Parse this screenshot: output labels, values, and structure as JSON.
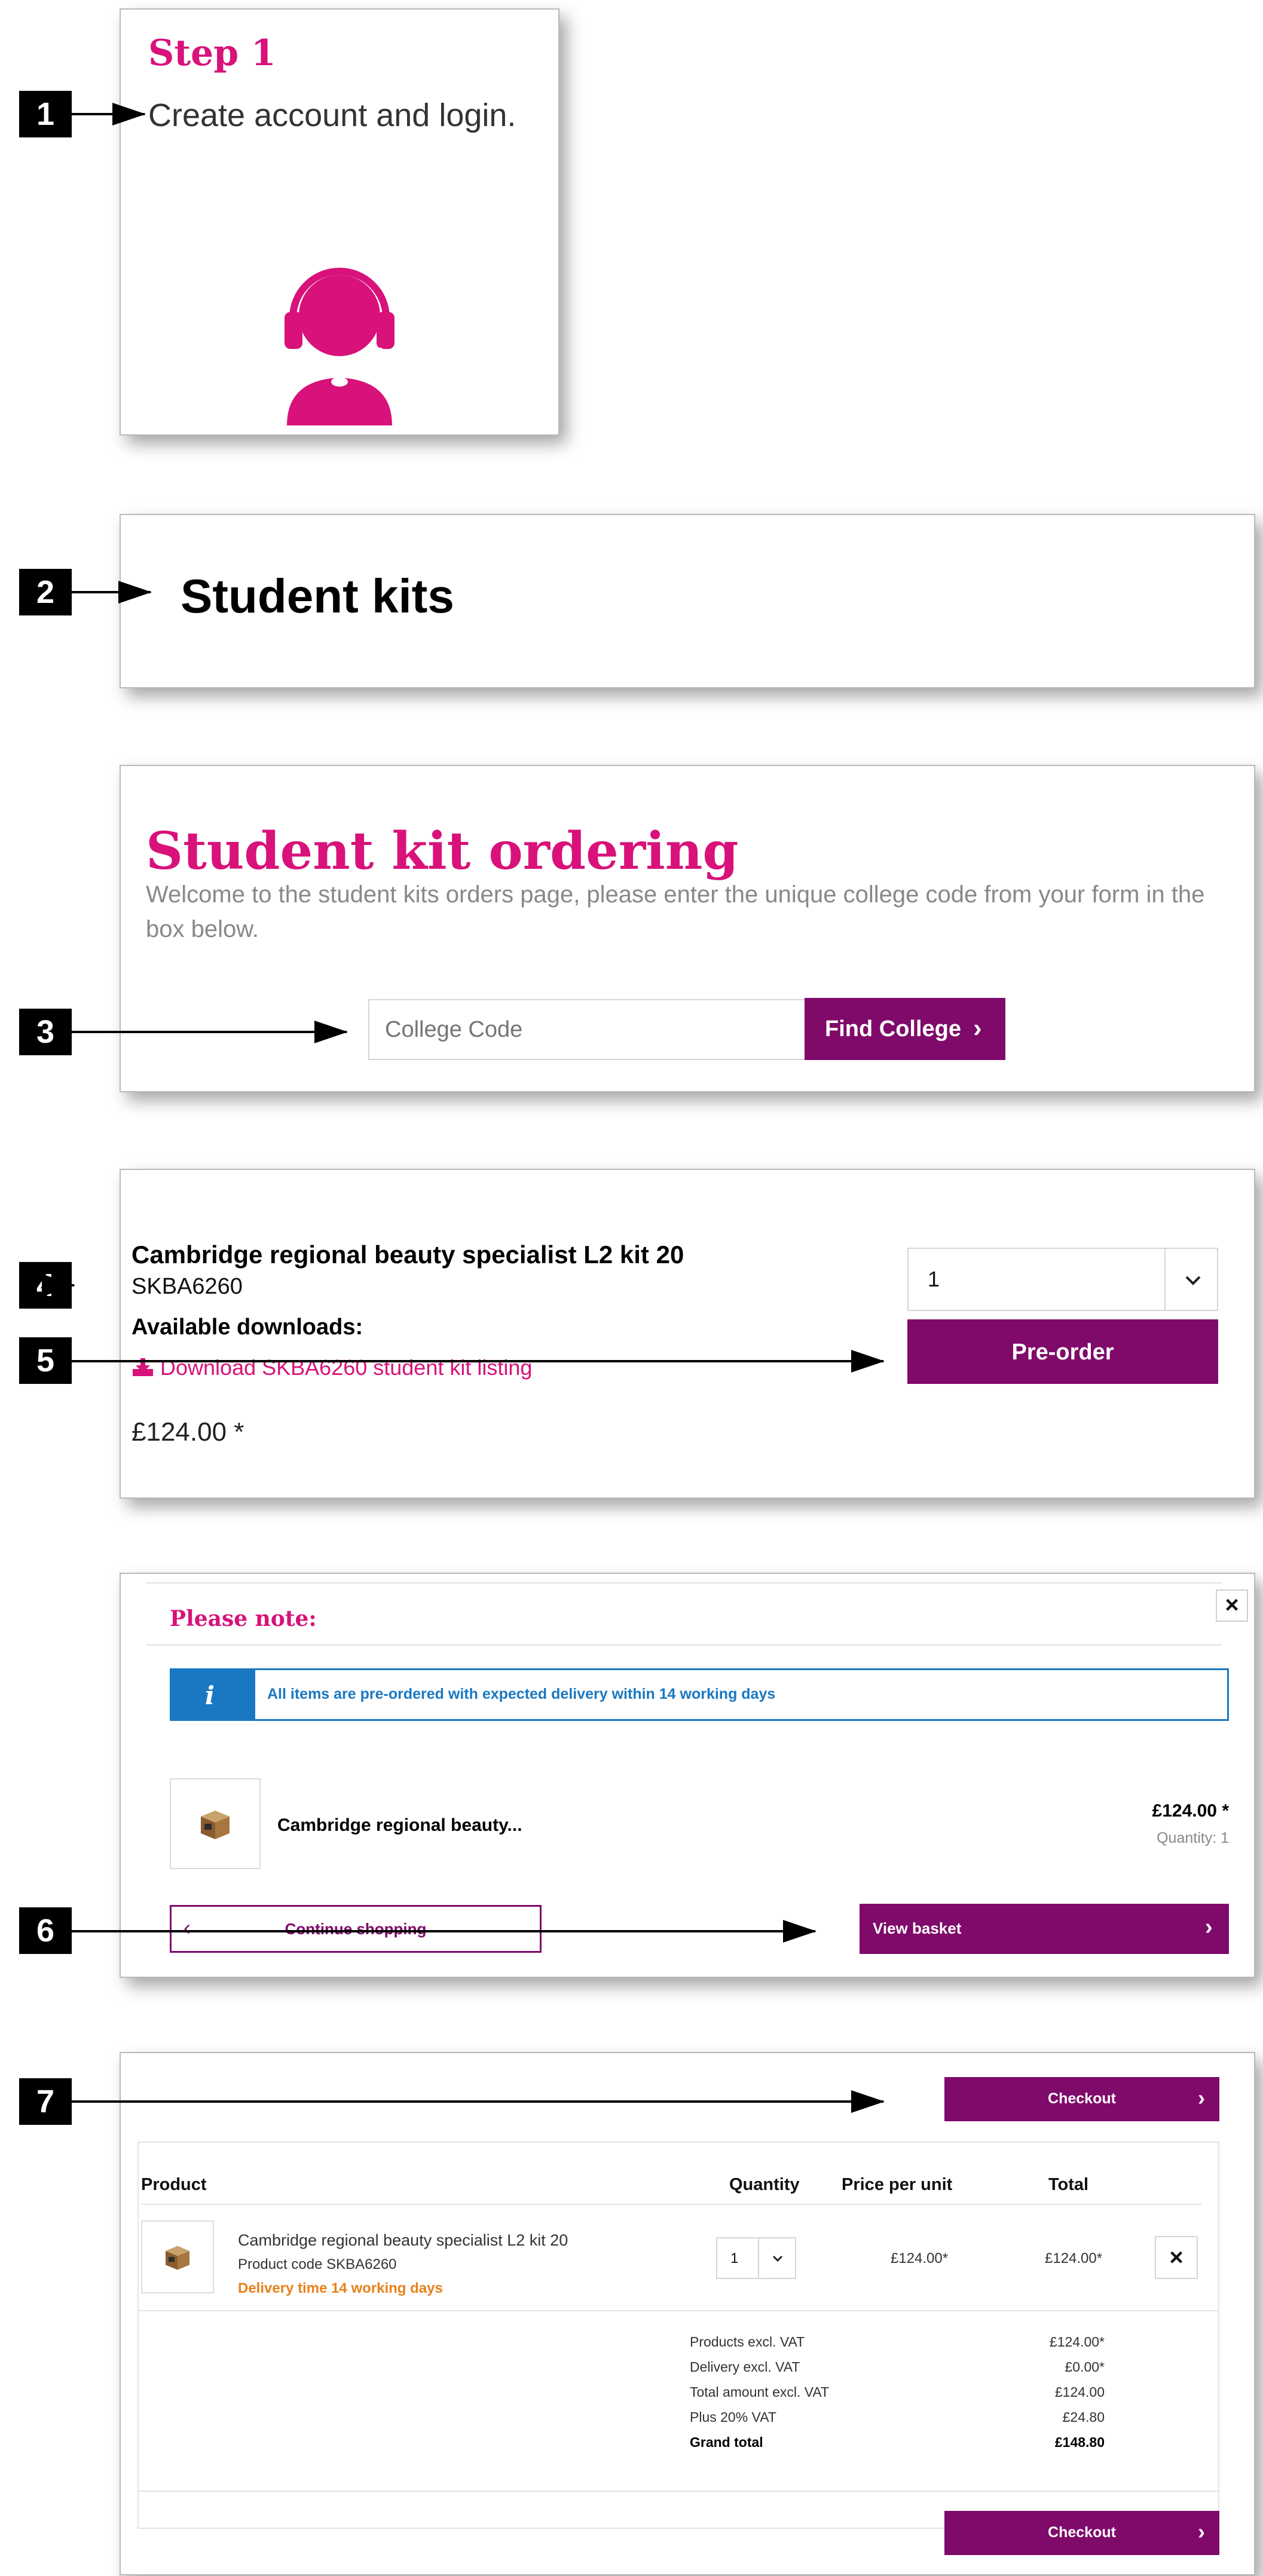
{
  "colors": {
    "brand_pink": "#d8127a",
    "brand_purple": "#7f0a6a",
    "info_blue": "#1a78c2",
    "delivery_orange": "#e8811a"
  },
  "badges": [
    "1",
    "2",
    "3",
    "4",
    "5",
    "6",
    "7"
  ],
  "step1": {
    "title": "Step 1",
    "text": "Create account and login.",
    "icon": "support-agent-icon"
  },
  "step2": {
    "title": "Student kits"
  },
  "step3": {
    "title": "Student kit ordering",
    "description": "Welcome to the student kits orders page, please enter the unique college code from your form in the box below.",
    "input_placeholder": "College Code",
    "button_label": "Find College",
    "button_icon": "chevron-right-icon"
  },
  "step4": {
    "product_name": "Cambridge regional beauty specialist L2 kit 20",
    "product_code": "SKBA6260",
    "downloads_heading": "Available downloads:",
    "download_link": "Download SKBA6260 student kit listing",
    "download_icon": "download-icon",
    "price": "£124.00 *",
    "quantity_value": "1",
    "select_icon": "chevron-down-icon",
    "preorder_label": "Pre-order"
  },
  "step6": {
    "title": "Please note:",
    "close_label": "×",
    "info_icon": "info-icon",
    "info_text": "All items are pre-ordered with expected delivery within 14 working days",
    "item_name": "Cambridge regional beauty...",
    "item_price": "£124.00 *",
    "item_quantity": "Quantity: 1",
    "continue_label": "Continue shopping",
    "view_basket_label": "View basket"
  },
  "step7": {
    "checkout_label": "Checkout",
    "table_headers": {
      "product": "Product",
      "quantity": "Quantity",
      "price_per_unit": "Price per unit",
      "total": "Total"
    },
    "item": {
      "name": "Cambridge regional beauty specialist L2 kit 20",
      "code": "Product code SKBA6260",
      "delivery": "Delivery time 14 working days",
      "quantity": "1",
      "unit_price": "£124.00*",
      "total": "£124.00*",
      "remove_label": "×"
    },
    "summary": [
      {
        "label": "Products excl. VAT",
        "value": "£124.00*"
      },
      {
        "label": "Delivery excl. VAT",
        "value": "£0.00*"
      },
      {
        "label": "Total amount excl. VAT",
        "value": "£124.00"
      },
      {
        "label": "Plus 20% VAT",
        "value": "£24.80"
      },
      {
        "label": "Grand total",
        "value": "£148.80"
      }
    ]
  }
}
